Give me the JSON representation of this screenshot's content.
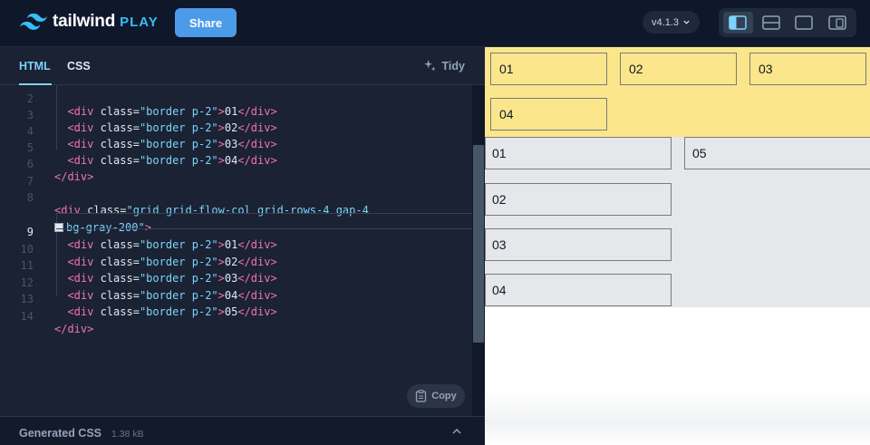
{
  "app": {
    "wordmark": "tailwind",
    "sub": "PLAY"
  },
  "topbar": {
    "share_label": "Share",
    "version": "v4.1.3"
  },
  "editor": {
    "tabs": {
      "html": "HTML",
      "css": "CSS"
    },
    "tidy_label": "Tidy",
    "copy_label": "Copy",
    "lines": [
      {
        "n": "2",
        "pre": "  ",
        "tag_open": "<div",
        "attr": " class",
        "eq": "=",
        "val": "\"border p-2\"",
        "close": ">",
        "text": "01",
        "end": "</div>"
      },
      {
        "n": "3",
        "pre": "  ",
        "tag_open": "<div",
        "attr": " class",
        "eq": "=",
        "val": "\"border p-2\"",
        "close": ">",
        "text": "02",
        "end": "</div>"
      },
      {
        "n": "4",
        "pre": "  ",
        "tag_open": "<div",
        "attr": " class",
        "eq": "=",
        "val": "\"border p-2\"",
        "close": ">",
        "text": "03",
        "end": "</div>"
      },
      {
        "n": "5",
        "pre": "  ",
        "tag_open": "<div",
        "attr": " class",
        "eq": "=",
        "val": "\"border p-2\"",
        "close": ">",
        "text": "04",
        "end": "</div>"
      },
      {
        "n": "6",
        "end_only": "</div>"
      },
      {
        "n": "7"
      },
      {
        "n": "8",
        "grid_open": "<div",
        "grid_attr": " class",
        "grid_val": "\"grid grid-flow-col grid-rows-4 gap-4"
      },
      {
        "n": "",
        "wrap_val": "bg-gray-200\"",
        "wrap_close": ">"
      },
      {
        "n": "9",
        "pre": "  ",
        "tag_open": "<div",
        "attr": " class",
        "eq": "=",
        "val": "\"border p-2\"",
        "close": ">",
        "text": "01",
        "end": "</div>",
        "current": true
      },
      {
        "n": "10",
        "pre": "  ",
        "tag_open": "<div",
        "attr": " class",
        "eq": "=",
        "val": "\"border p-2\"",
        "close": ">",
        "text": "02",
        "end": "</div>"
      },
      {
        "n": "11",
        "pre": "  ",
        "tag_open": "<div",
        "attr": " class",
        "eq": "=",
        "val": "\"border p-2\"",
        "close": ">",
        "text": "03",
        "end": "</div>"
      },
      {
        "n": "12",
        "pre": "  ",
        "tag_open": "<div",
        "attr": " class",
        "eq": "=",
        "val": "\"border p-2\"",
        "close": ">",
        "text": "04",
        "end": "</div>"
      },
      {
        "n": "13",
        "pre": "  ",
        "tag_open": "<div",
        "attr": " class",
        "eq": "=",
        "val": "\"border p-2\"",
        "close": ">",
        "text": "05",
        "end": "</div>"
      },
      {
        "n": "14",
        "end_only": "</div>"
      }
    ]
  },
  "generated_css": {
    "label": "Generated CSS",
    "size": "1.38 kB"
  },
  "preview": {
    "grid1": [
      "01",
      "02",
      "03",
      "04"
    ],
    "grid2": [
      "01",
      "02",
      "03",
      "04",
      "05"
    ]
  },
  "colors": {
    "accent": "#38bdf8",
    "share": "#4c9be8",
    "yellow": "#fce68c",
    "gray": "#e5e7eb"
  }
}
